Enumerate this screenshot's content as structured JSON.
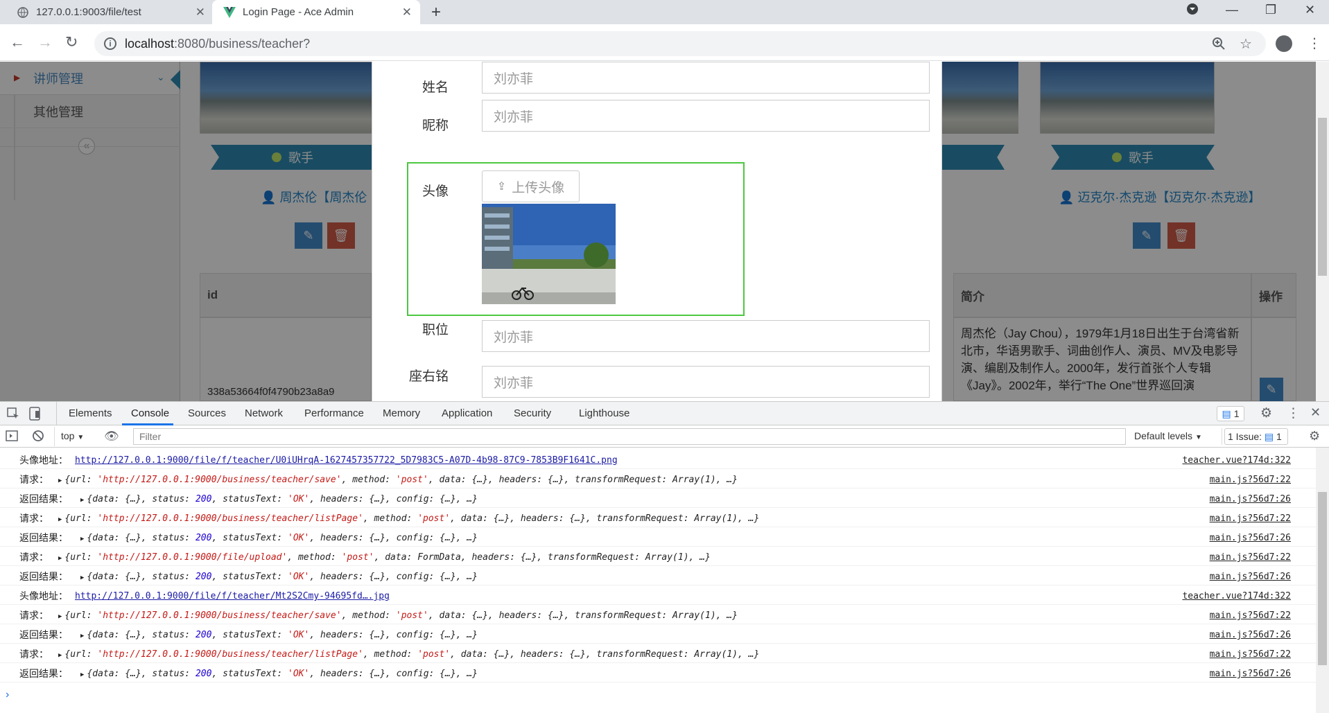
{
  "browser": {
    "tabs": [
      {
        "title": "127.0.0.1:9003/file/test"
      },
      {
        "title": "Login Page - Ace Admin"
      }
    ],
    "url_host": "localhost",
    "url_path": ":8080/business/teacher?"
  },
  "sidebar": {
    "items": [
      {
        "label": "讲师管理"
      },
      {
        "label": "其他管理"
      }
    ]
  },
  "cards": [
    {
      "position": "歌手",
      "name": "周杰伦【周杰伦"
    },
    {
      "position": "歌手",
      "name": "迈克尔·杰克逊【迈克尔·杰克逊】"
    }
  ],
  "table": {
    "headers": {
      "id": "id",
      "intro": "简介",
      "ops": "操作"
    },
    "row": {
      "id": "338a53664f0f4790b23a8a9",
      "intro": "周杰伦（Jay Chou），1979年1月18日出生于台湾省新北市，华语男歌手、词曲创作人、演员、MV及电影导演、编剧及制作人。2000年，发行首张个人专辑《Jay》。2002年，举行“The One”世界巡回演"
    }
  },
  "form": {
    "name_label": "姓名",
    "name_value": "刘亦菲",
    "nickname_label": "昵称",
    "nickname_value": "刘亦菲",
    "avatar_label": "头像",
    "upload_label": "上传头像",
    "position_label": "职位",
    "position_value": "刘亦菲",
    "motto_label": "座右铭",
    "motto_value": "刘亦菲"
  },
  "devtools": {
    "tabs": [
      "Elements",
      "Console",
      "Sources",
      "Network",
      "Performance",
      "Memory",
      "Application",
      "Security",
      "Lighthouse"
    ],
    "issues_badge": "1",
    "context": "top",
    "filter_placeholder": "Filter",
    "levels": "Default levels",
    "issue_label": "1 Issue:",
    "issue_count": "1",
    "logs": [
      {
        "label": "头像地址：",
        "kind": "link",
        "text": "http://127.0.0.1:9000/file/f/teacher/U0iUHrqA-1627457357722_5D7983C5-A07D-4b98-87C9-7853B9F1641C.png",
        "source": "teacher.vue?174d:322"
      },
      {
        "label": "请求：",
        "kind": "req",
        "url": "'http://127.0.0.1:9000/business/teacher/save'",
        "method": "'post'",
        "rest": ", data: {…}, headers: {…}, transformRequest: Array(1), …}",
        "source": "main.js?56d7:22"
      },
      {
        "label": "返回结果：",
        "kind": "res",
        "status": "200",
        "statusText": "'OK'",
        "source": "main.js?56d7:26"
      },
      {
        "label": "请求：",
        "kind": "req",
        "url": "'http://127.0.0.1:9000/business/teacher/listPage'",
        "method": "'post'",
        "rest": ", data: {…}, headers: {…}, transformRequest: Array(1), …}",
        "source": "main.js?56d7:22"
      },
      {
        "label": "返回结果：",
        "kind": "res",
        "status": "200",
        "statusText": "'OK'",
        "source": "main.js?56d7:26"
      },
      {
        "label": "请求：",
        "kind": "req",
        "url": "'http://127.0.0.1:9000/file/upload'",
        "method": "'post'",
        "rest": ", data: FormData, headers: {…}, transformRequest: Array(1), …}",
        "source": "main.js?56d7:22"
      },
      {
        "label": "返回结果：",
        "kind": "res",
        "status": "200",
        "statusText": "'OK'",
        "source": "main.js?56d7:26"
      },
      {
        "label": "头像地址：",
        "kind": "link",
        "text": "http://127.0.0.1:9000/file/f/teacher/Mt2S2Cmy-94695fd….jpg",
        "source": "teacher.vue?174d:322"
      },
      {
        "label": "请求：",
        "kind": "req",
        "url": "'http://127.0.0.1:9000/business/teacher/save'",
        "method": "'post'",
        "rest": ", data: {…}, headers: {…}, transformRequest: Array(1), …}",
        "source": "main.js?56d7:22"
      },
      {
        "label": "返回结果：",
        "kind": "res",
        "status": "200",
        "statusText": "'OK'",
        "source": "main.js?56d7:26"
      },
      {
        "label": "请求：",
        "kind": "req",
        "url": "'http://127.0.0.1:9000/business/teacher/listPage'",
        "method": "'post'",
        "rest": ", data: {…}, headers: {…}, transformRequest: Array(1), …}",
        "source": "main.js?56d7:22"
      },
      {
        "label": "返回结果：",
        "kind": "res",
        "status": "200",
        "statusText": "'OK'",
        "source": "main.js?56d7:26"
      }
    ],
    "prompt": "›"
  },
  "colors": {
    "accent": "#1a73e8",
    "highlight_border": "#4cc740",
    "ribbon": "#2e8bb3"
  }
}
